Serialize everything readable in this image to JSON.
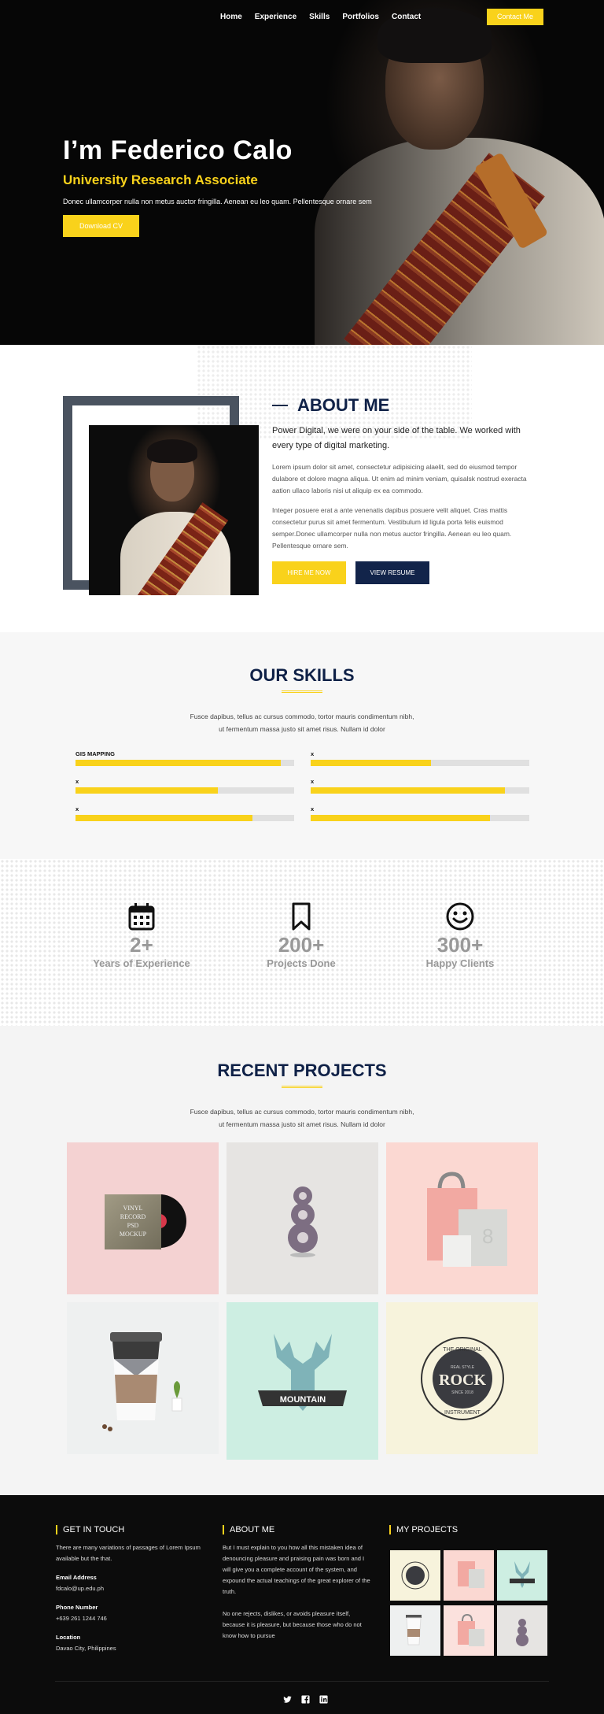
{
  "nav": {
    "items": [
      "Home",
      "Experience",
      "Skills",
      "Portfolios",
      "Contact"
    ],
    "contact_button": "Contact Me"
  },
  "hero": {
    "name": "I’m Federico Calo",
    "role": "University Research Associate",
    "tagline": "Donec ullamcorper nulla non metus auctor fringilla. Aenean eu leo quam. Pellentesque ornare sem",
    "download_button": "Download CV"
  },
  "about": {
    "title": "ABOUT ME",
    "lead": "Power Digital, we were on your side of the table. We worked with every type of digital marketing.",
    "para1": "Lorem ipsum dolor sit amet, consectetur adipisicing alaelit, sed do eiusmod tempor dulabore et dolore magna aliqua. Ut enim ad minim veniam, quisalsk nostrud exeracta aation ullaco laboris nisi ut aliquip ex ea commodo.",
    "para2": "Integer posuere erat a ante venenatis dapibus posuere velit aliquet. Cras mattis consectetur purus sit amet fermentum. Vestibulum id ligula porta felis euismod semper.Donec ullamcorper nulla non metus auctor fringilla. Aenean eu leo quam. Pellentesque ornare sem.",
    "hire_button": "HIRE ME NOW",
    "resume_button": "VIEW RESUME"
  },
  "skills": {
    "title": "OUR SKILLS",
    "subtitle_line1": "Fusce dapibus, tellus ac cursus commodo, tortor mauris condimentum nibh,",
    "subtitle_line2": "ut fermentum massa justo sit amet risus. Nullam id dolor",
    "items": [
      {
        "label": "GIS MAPPING",
        "level": 0.94
      },
      {
        "label": "x",
        "level": 0.55
      },
      {
        "label": "x",
        "level": 0.65
      },
      {
        "label": "x",
        "level": 0.89
      },
      {
        "label": "x",
        "level": 0.81
      },
      {
        "label": "x",
        "level": 0.82
      }
    ],
    "bar_color": "#f9d21b"
  },
  "counters": [
    {
      "icon": "calendar-icon",
      "number": "2+",
      "label": "Years of Experience"
    },
    {
      "icon": "bookmark-icon",
      "number": "200+",
      "label": "Projects Done"
    },
    {
      "icon": "smiley-icon",
      "number": "300+",
      "label": "Happy Clients"
    }
  ],
  "projects": {
    "title": "RECENT PROJECTS",
    "subtitle_line1": "Fusce dapibus, tellus ac cursus commodo, tortor mauris condimentum nibh,",
    "subtitle_line2": "ut fermentum massa justo sit amet risus. Nullam id dolor",
    "vinyl_text": [
      "VINYL",
      "RECORD",
      "PSD",
      "MOCKUP"
    ],
    "mountain_text": "MOUNTAIN",
    "rock_badge": {
      "top": "THE ORIGINAL",
      "small": "REAL STYLE",
      "word": "ROCK",
      "since": "SINCE 2018",
      "bottom": "INSTRUMENT"
    }
  },
  "footer": {
    "get_in_touch": {
      "title": "GET IN TOUCH",
      "text": "There are many variations of passages of Lorem Ipsum available but the that.",
      "email_label": "Email Address",
      "email": "fdcalo@up.edu.ph",
      "phone_label": "Phone Number",
      "phone": "+639 261 1244 746",
      "location_label": "Location",
      "location": "Davao City, Philippines"
    },
    "about": {
      "title": "ABOUT ME",
      "text1": "But I must explain to you how all this mistaken idea of denouncing pleasure and praising pain was born and I will give you a complete account of the system, and expound the actual teachings of the great explorer of the truth.",
      "text2": "No one rejects, dislikes, or avoids pleasure itself, because it is pleasure, but because those who do not know how to pursue"
    },
    "my_projects": {
      "title": "MY PROJECTS"
    },
    "socials": [
      "twitter-icon",
      "facebook-icon",
      "linkedin-icon"
    ]
  },
  "colors": {
    "accent": "#f9d21b",
    "navy": "#0f2147",
    "dark": "#0c0c0c"
  }
}
